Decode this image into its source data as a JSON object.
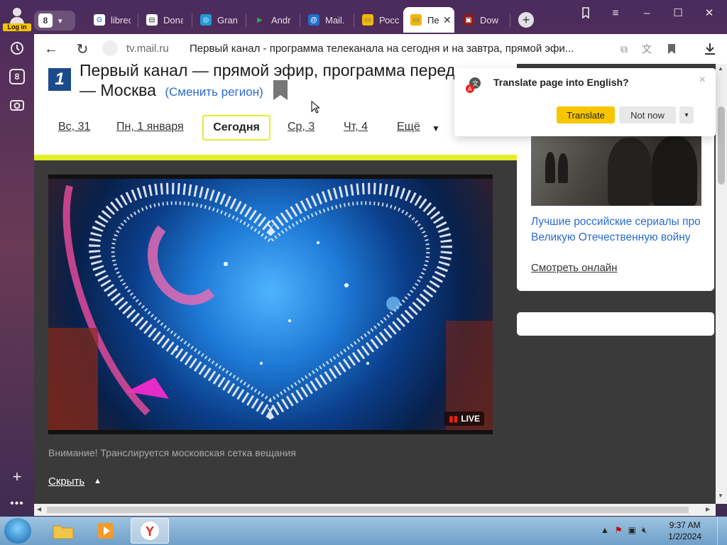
{
  "browser": {
    "sidebar": {
      "login_label": "Log in",
      "tab_count_badge": "8"
    },
    "tab_counter": "8",
    "tabs": [
      {
        "title": "librec",
        "favicon": "google-icon"
      },
      {
        "title": "Dona",
        "favicon": "document-icon"
      },
      {
        "title": "Grand",
        "favicon": "grand-icon"
      },
      {
        "title": "Andr",
        "favicon": "play-icon"
      },
      {
        "title": "Mail.",
        "favicon": "mail-icon"
      },
      {
        "title": "Росс",
        "favicon": "tv-icon"
      },
      {
        "title": "Пе",
        "favicon": "tv-icon",
        "active": true
      },
      {
        "title": "Dow",
        "favicon": "download-site-icon"
      }
    ],
    "address": {
      "domain": "tv.mail.ru",
      "title": "Первый канал - программа телеканала на сегодня и на завтра, прямой эфи..."
    }
  },
  "page": {
    "logo_char": "1",
    "title_line1": "Первый канал — прямой эфир, программа перед",
    "title_line2": "— Москва",
    "change_region": "(Сменить регион)",
    "days": [
      {
        "label": "Вс, 31"
      },
      {
        "label": "Пн, 1 января"
      },
      {
        "label": "Ср, 3"
      },
      {
        "label": "Чт, 4"
      }
    ],
    "today": "Сегодня",
    "more": "Ещё",
    "live_label": "LIVE",
    "notice": "Внимание! Транслируется московская сетка вещания",
    "hide": "Скрыть",
    "promo": {
      "title": "Лучшие российские сериалы про Великую Отечественную войну",
      "cta": "Смотреть онлайн"
    }
  },
  "translate_popup": {
    "title": "Translate page into English?",
    "translate_button": "Translate",
    "not_now_button": "Not now",
    "close": "×"
  },
  "taskbar": {
    "time": "9:37 AM",
    "date": "1/2/2024"
  },
  "colors": {
    "accent_yellow": "#e3ef29",
    "translate_yellow": "#f7c600",
    "link_blue": "#2a6bd1",
    "page_dark": "#3a3a3a"
  }
}
